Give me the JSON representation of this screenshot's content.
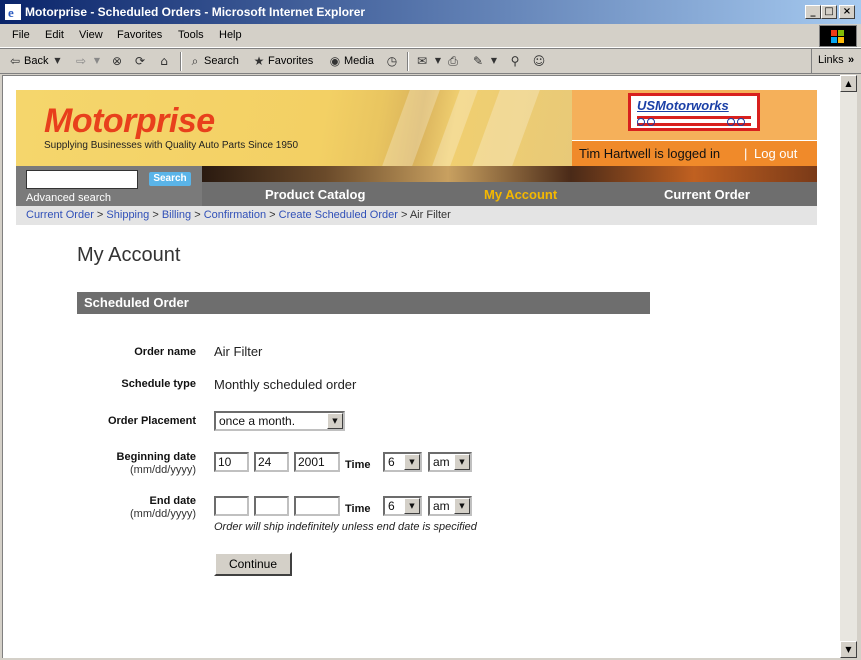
{
  "window": {
    "title": "Motorprise - Scheduled Orders - Microsoft Internet Explorer",
    "controls": [
      "_",
      "□",
      "×"
    ]
  },
  "menu": [
    "File",
    "Edit",
    "View",
    "Favorites",
    "Tools",
    "Help"
  ],
  "toolbar": {
    "back": "Back",
    "search": "Search",
    "favorites": "Favorites",
    "media": "Media",
    "links": "Links"
  },
  "header": {
    "brand": "Motorprise",
    "tagline": "Supplying Businesses with Quality Auto Parts Since 1950",
    "partner": "USMotorworks",
    "login_text": "Tim Hartwell is logged in",
    "separator": "|",
    "logout": "Log out"
  },
  "search": {
    "button": "Search",
    "advanced": "Advanced search",
    "value": ""
  },
  "nav": {
    "items": [
      "Product Catalog",
      "My Account",
      "Current Order"
    ],
    "active": "My Account"
  },
  "breadcrumb": {
    "links": [
      "Current Order",
      "Shipping",
      "Billing",
      "Confirmation",
      "Create Scheduled Order"
    ],
    "separator": ">",
    "current": "Air Filter"
  },
  "page": {
    "title": "My Account",
    "section": "Scheduled Order"
  },
  "form": {
    "order_name_label": "Order name",
    "order_name_value": "Air Filter",
    "schedule_type_label": "Schedule type",
    "schedule_type_value": "Monthly scheduled order",
    "placement_label": "Order Placement",
    "placement_value": "once a month.",
    "begin_label": "Beginning date",
    "date_format": "(mm/dd/yyyy)",
    "begin_month": "10",
    "begin_day": "24",
    "begin_year": "2001",
    "time_label": "Time",
    "begin_hour": "6",
    "begin_ampm": "am",
    "end_label": "End date",
    "end_month": "",
    "end_day": "",
    "end_year": "",
    "end_hour": "6",
    "end_ampm": "am",
    "end_hint": "Order will ship indefinitely unless end date is specified",
    "continue": "Continue"
  },
  "colors": {
    "brand_red": "#e8401c",
    "nav_active": "#f5b800",
    "link_blue": "#3050b8",
    "section_gray": "#6e6e6e"
  }
}
